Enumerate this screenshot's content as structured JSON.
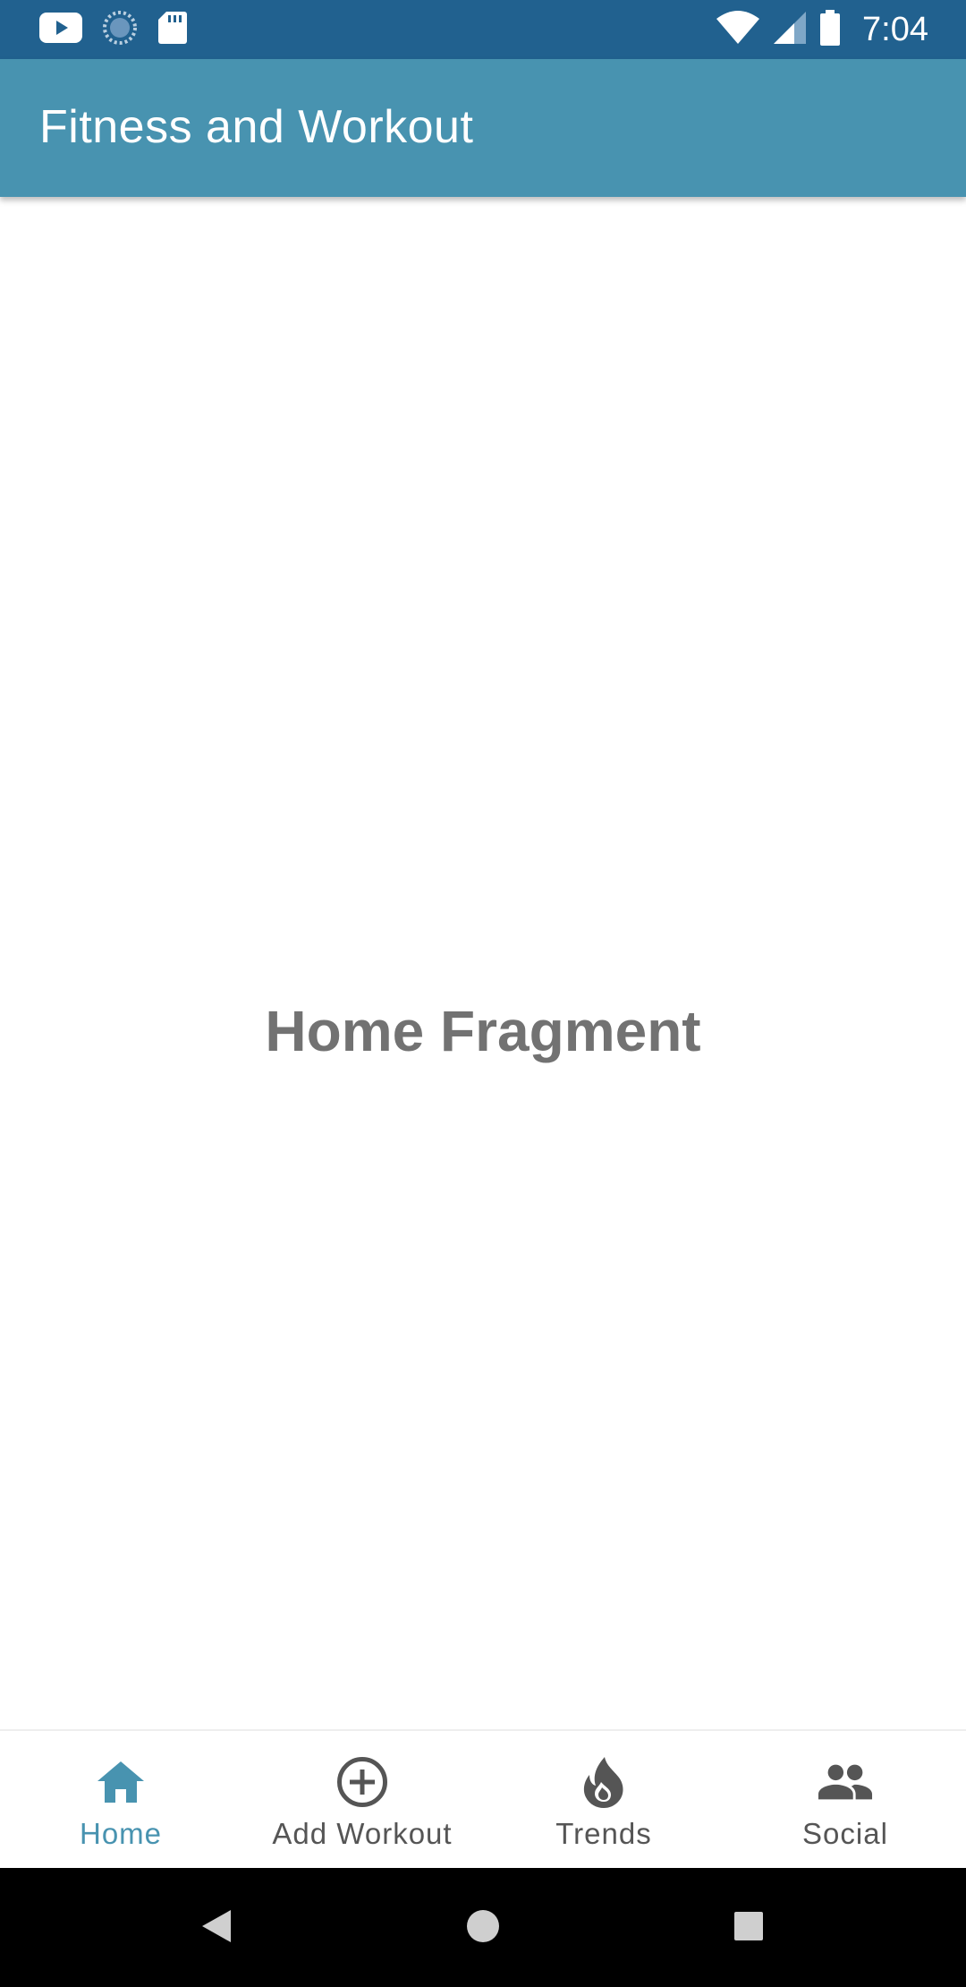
{
  "status_bar": {
    "time": "7:04",
    "icons_left": [
      "youtube-icon",
      "sync-icon",
      "sd-card-icon"
    ],
    "icons_right": [
      "wifi-icon",
      "cell-signal-icon",
      "battery-icon"
    ]
  },
  "app_bar": {
    "title": "Fitness and Workout"
  },
  "content": {
    "fragment_label": "Home Fragment"
  },
  "bottom_nav": {
    "active_index": 0,
    "items": [
      {
        "label": "Home",
        "icon": "home-icon"
      },
      {
        "label": "Add Workout",
        "icon": "add-circle-icon"
      },
      {
        "label": "Trends",
        "icon": "flame-icon"
      },
      {
        "label": "Social",
        "icon": "people-icon"
      }
    ]
  },
  "system_nav": {
    "buttons": [
      "back-icon",
      "home-circle-icon",
      "recents-icon"
    ]
  },
  "colors": {
    "status_bar": "#21618f",
    "app_bar": "#4893b0",
    "accent": "#4893b0",
    "inactive": "#555555",
    "fragment_text": "#727272"
  }
}
